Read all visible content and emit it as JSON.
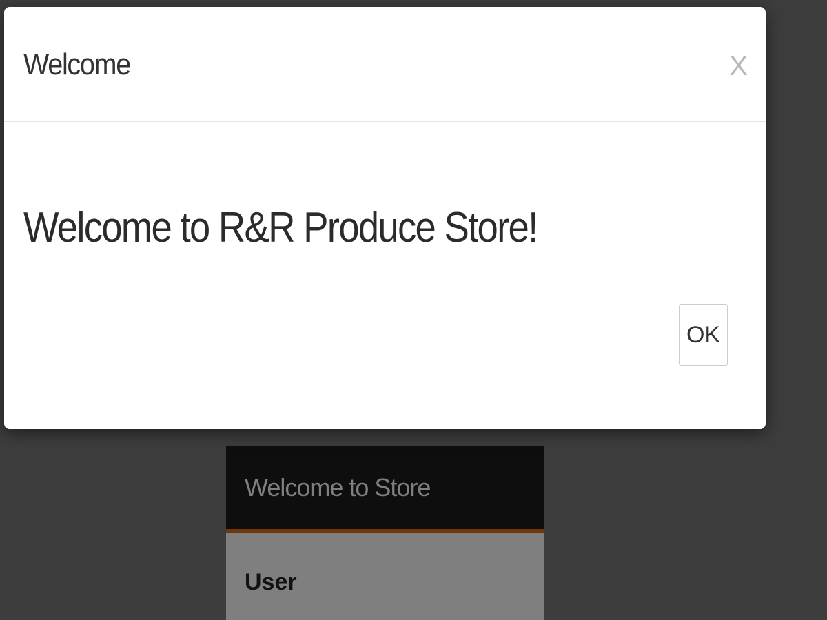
{
  "background": {
    "panel": {
      "title": "Welcome to Store",
      "user_label": "User"
    }
  },
  "modal": {
    "title": "Welcome",
    "close_label": "X",
    "message": "Welcome to R&R Produce Store!",
    "ok_label": "OK"
  },
  "colors": {
    "panel_header_bg": "#1d1d1d",
    "panel_accent": "#e07010",
    "overlay": "#7b7b7b"
  }
}
